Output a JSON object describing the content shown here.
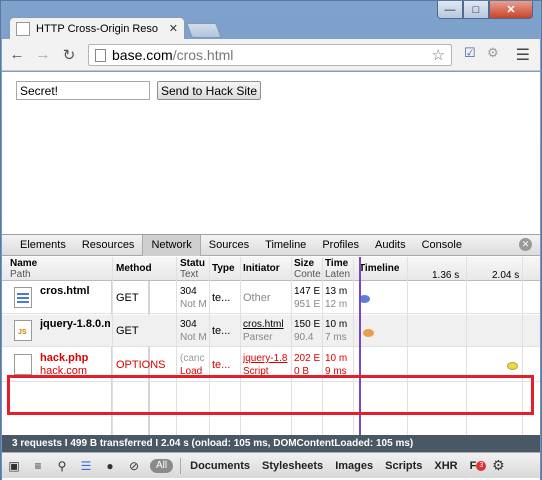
{
  "browser": {
    "tab_title": "HTTP Cross-Origin Reso",
    "url_host": "base.com",
    "url_path": "/cros.html"
  },
  "page": {
    "secret_value": "Secret!",
    "send_button_label": "Send to Hack Site"
  },
  "devtools": {
    "tabs": [
      "Elements",
      "Resources",
      "Network",
      "Sources",
      "Timeline",
      "Profiles",
      "Audits",
      "Console"
    ],
    "active_tab": "Network",
    "headers": {
      "name": "Name",
      "path": "Path",
      "method": "Method",
      "status": "Statu",
      "status_sub": "Text",
      "type": "Type",
      "initiator": "Initiator",
      "size": "Size",
      "size_sub": "Conte",
      "time": "Time",
      "time_sub": "Laten",
      "timeline": "Timeline",
      "tick1": "1.36 s",
      "tick2": "2.04 s"
    },
    "requests": [
      {
        "name": "cros.html",
        "path": "",
        "method": "GET",
        "status": "304",
        "status_text": "Not M",
        "type": "te...",
        "initiator": "Other",
        "initiator_sub": "",
        "size": "147 E",
        "size_sub": "951 E",
        "time": "13 m",
        "time_sub": "12 m",
        "icon": "html-file-icon",
        "color": "#5b7fd6"
      },
      {
        "name": "jquery-1.8.0.m",
        "path": "",
        "method": "GET",
        "status": "304",
        "status_text": "Not M",
        "type": "te...",
        "initiator": "cros.html",
        "initiator_sub": "Parser",
        "size": "150 E",
        "size_sub": "90.4",
        "time": "10 m",
        "time_sub": "7 ms",
        "icon": "js-file-icon",
        "color": "#e8a04c"
      },
      {
        "name": "hack.php",
        "path": "hack.com",
        "method": "OPTIONS",
        "status": "(canc",
        "status_text": "Load",
        "type": "te...",
        "initiator": "jquery-1.8",
        "initiator_sub": "Script",
        "size": "202 E",
        "size_sub": "0 B",
        "time": "10 m",
        "time_sub": "9 ms",
        "icon": "blank-file-icon",
        "color": "#e8d84c"
      }
    ],
    "status_bar": "3 requests  I  499 B transferred  I  2.04 s (onload: 105 ms, DOMContentLoaded: 105 ms)",
    "filters": [
      "All",
      "Documents",
      "Stylesheets",
      "Images",
      "Scripts",
      "XHR",
      "F"
    ],
    "error_count": "3"
  }
}
